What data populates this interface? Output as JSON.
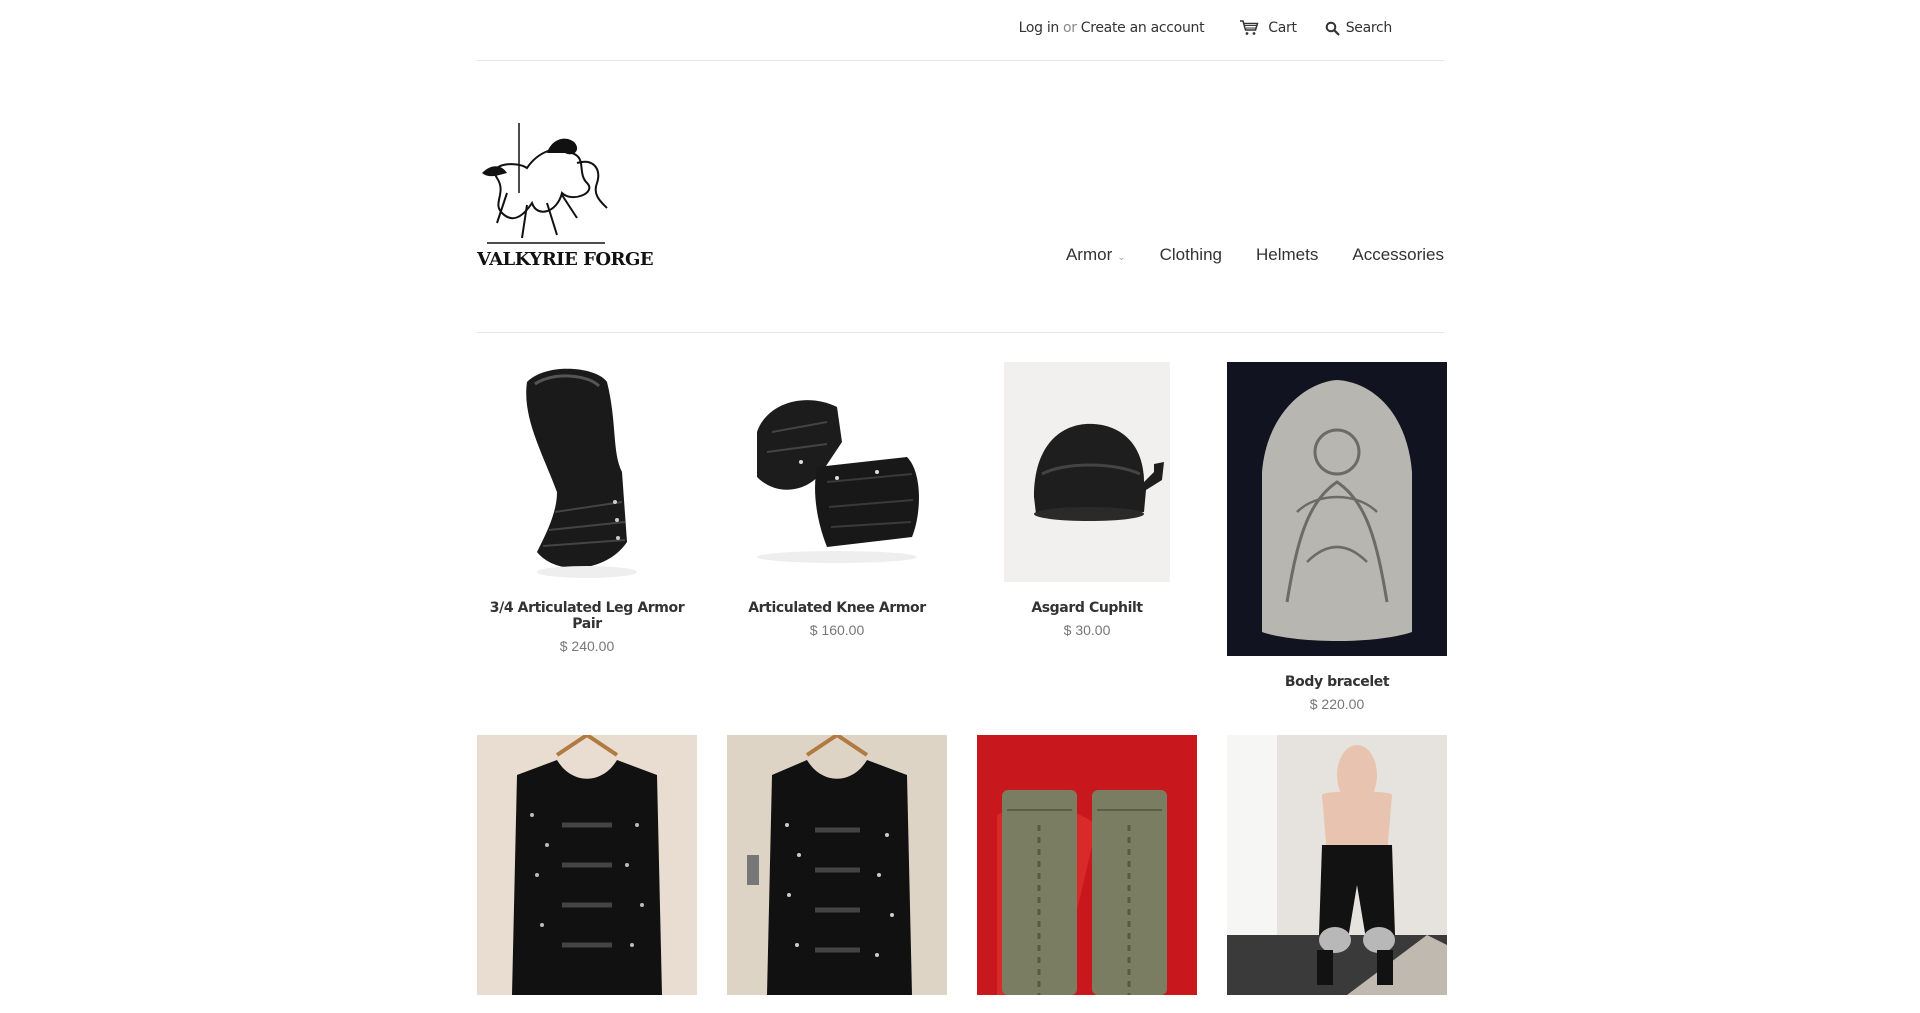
{
  "topbar": {
    "login": "Log in",
    "or": "or",
    "create_account": "Create an account",
    "cart": "Cart",
    "search": "Search"
  },
  "brand": {
    "logo_text": "VALKYRIE FORGE"
  },
  "nav": {
    "items": [
      {
        "label": "Armor",
        "has_dropdown": true
      },
      {
        "label": "Clothing"
      },
      {
        "label": "Helmets"
      },
      {
        "label": "Accessories"
      }
    ]
  },
  "products": [
    {
      "name": "3/4 Articulated Leg Armor Pair",
      "price": "$ 240.00"
    },
    {
      "name": "Articulated Knee Armor",
      "price": "$ 160.00"
    },
    {
      "name": "Asgard Cuphilt",
      "price": "$ 30.00"
    },
    {
      "name": "Body bracelet",
      "price": "$ 220.00"
    },
    {
      "name": "",
      "price": ""
    },
    {
      "name": "",
      "price": ""
    },
    {
      "name": "",
      "price": ""
    },
    {
      "name": "",
      "price": ""
    }
  ],
  "colors": {
    "text": "#333333",
    "price": "#777777",
    "divider": "#e5e5e5"
  }
}
